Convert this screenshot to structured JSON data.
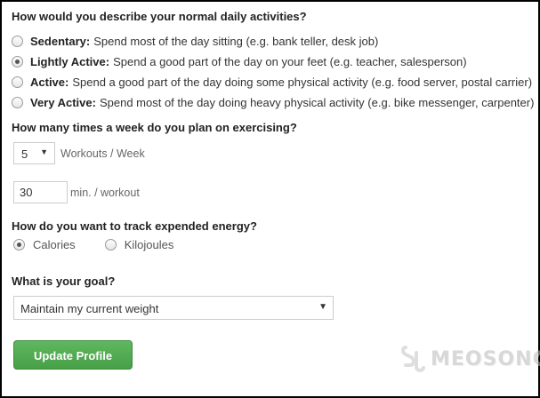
{
  "activity": {
    "question": "How would you describe your normal daily activities?",
    "options": [
      {
        "label": "Sedentary:",
        "description": "Spend most of the day sitting (e.g. bank teller, desk job)",
        "checked": false
      },
      {
        "label": "Lightly Active:",
        "description": "Spend a good part of the day on your feet (e.g. teacher, salesperson)",
        "checked": true
      },
      {
        "label": "Active:",
        "description": "Spend a good part of the day doing some physical activity (e.g. food server, postal carrier)",
        "checked": false
      },
      {
        "label": "Very Active:",
        "description": "Spend most of the day doing heavy physical activity (e.g. bike messenger, carpenter)",
        "checked": false
      }
    ]
  },
  "exercise": {
    "question": "How many times a week do you plan on exercising?",
    "workouts_value": "5",
    "workouts_unit": "Workouts / Week",
    "minutes_value": "30",
    "minutes_unit": "min. / workout"
  },
  "energy": {
    "question": "How do you want to track expended energy?",
    "options": [
      {
        "label": "Calories",
        "checked": true
      },
      {
        "label": "Kilojoules",
        "checked": false
      }
    ]
  },
  "goal": {
    "question": "What is your goal?",
    "selected": "Maintain my current weight"
  },
  "submit_label": "Update Profile",
  "watermark": "MEOSONG",
  "colors": {
    "button": "#4cae4c",
    "border": "#cccccc",
    "frame": "#000000"
  }
}
